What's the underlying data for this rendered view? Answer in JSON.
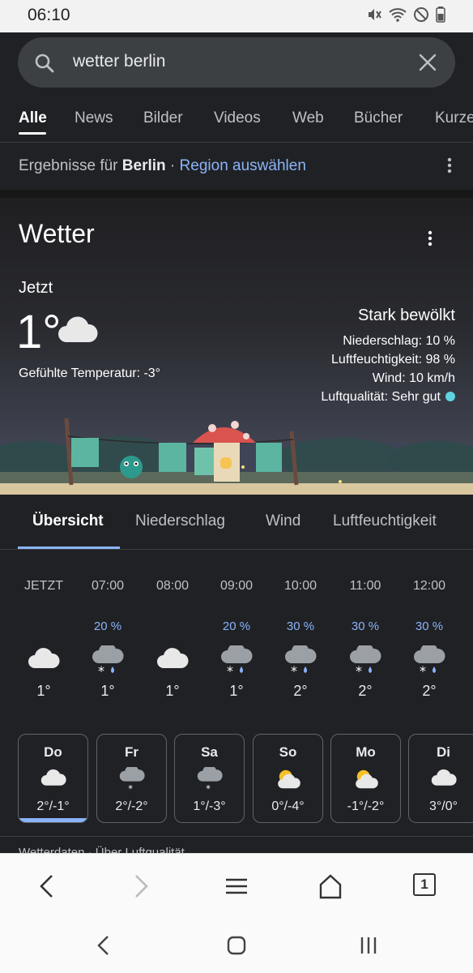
{
  "status_bar": {
    "time": "06:10"
  },
  "search": {
    "query": "wetter berlin"
  },
  "tabs": [
    {
      "label": "Alle"
    },
    {
      "label": "News"
    },
    {
      "label": "Bilder"
    },
    {
      "label": "Videos"
    },
    {
      "label": "Web"
    },
    {
      "label": "Bücher"
    },
    {
      "label": "Kurze"
    }
  ],
  "region": {
    "prefix": "Ergebnisse für ",
    "city": "Berlin",
    "sep": " · ",
    "link": "Region auswählen"
  },
  "weather": {
    "title": "Wetter",
    "now_label": "Jetzt",
    "temperature": "1°",
    "feels_like": "Gefühlte Temperatur: -3°",
    "condition": "Stark bewölkt",
    "precipitation": "Niederschlag: 10 %",
    "humidity": "Luftfeuchtigkeit: 98 %",
    "wind": "Wind: 10 km/h",
    "air_quality": "Luftqualität: Sehr gut",
    "colors": {
      "air_quality_dot": "#5fd3e0",
      "accent": "#8ab4f8"
    }
  },
  "subtabs": [
    {
      "label": "Übersicht"
    },
    {
      "label": "Niederschlag"
    },
    {
      "label": "Wind"
    },
    {
      "label": "Luftfeuchtigkeit"
    }
  ],
  "hourly": [
    {
      "time": "JETZT",
      "prob": "",
      "icon": "cloud-icon",
      "temp": "1°"
    },
    {
      "time": "07:00",
      "prob": "20 %",
      "icon": "snow-rain-icon",
      "temp": "1°"
    },
    {
      "time": "08:00",
      "prob": "",
      "icon": "cloud-icon",
      "temp": "1°"
    },
    {
      "time": "09:00",
      "prob": "20 %",
      "icon": "snow-rain-icon",
      "temp": "1°"
    },
    {
      "time": "10:00",
      "prob": "30 %",
      "icon": "snow-rain-icon",
      "temp": "2°"
    },
    {
      "time": "11:00",
      "prob": "30 %",
      "icon": "snow-rain-icon",
      "temp": "2°"
    },
    {
      "time": "12:00",
      "prob": "30 %",
      "icon": "snow-rain-icon",
      "temp": "2°"
    }
  ],
  "daily": [
    {
      "day": "Do",
      "icon": "cloud-icon",
      "temps": "2°/-1°",
      "selected": true
    },
    {
      "day": "Fr",
      "icon": "snow-cloud-icon",
      "temps": "2°/-2°",
      "selected": false
    },
    {
      "day": "Sa",
      "icon": "snow-cloud-icon",
      "temps": "1°/-3°",
      "selected": false
    },
    {
      "day": "So",
      "icon": "sun-cloud-icon",
      "temps": "0°/-4°",
      "selected": false
    },
    {
      "day": "Mo",
      "icon": "sun-cloud-icon",
      "temps": "-1°/-2°",
      "selected": false
    },
    {
      "day": "Di",
      "icon": "cloud-icon",
      "temps": "3°/0°",
      "selected": false
    }
  ],
  "footer_partial": "Wetterdaten · Über Luftqualität",
  "browser": {
    "tab_count": "1"
  }
}
